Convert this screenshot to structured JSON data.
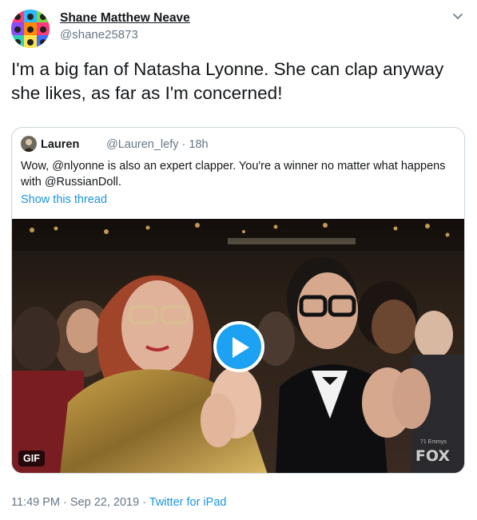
{
  "author": {
    "name": "Shane Matthew Neave",
    "handle": "@shane25873"
  },
  "tweet_text": "I'm a big fan of Natasha Lyonne.  She can clap anyway she likes, as far as I'm concerned!",
  "quoted": {
    "name": "Lauren",
    "meta": "@Lauren_lefy · 18h",
    "text": "Wow, @nlyonne is also an expert clapper. You're a winner no matter what happens with @RussianDoll.",
    "thread_link": "Show this thread",
    "media_badge": "GIF",
    "watermark_network": "FOX",
    "watermark_show": "71 Emmys"
  },
  "footer": {
    "timestamp": "11:49 PM · Sep 22, 2019 · ",
    "source": "Twitter for iPad"
  },
  "colors": {
    "link": "#1b95e0",
    "play_button": "#1da1f2",
    "muted": "#657786",
    "border": "#ccd6dd"
  },
  "icons": [
    "chevron-down-icon",
    "play-icon"
  ]
}
